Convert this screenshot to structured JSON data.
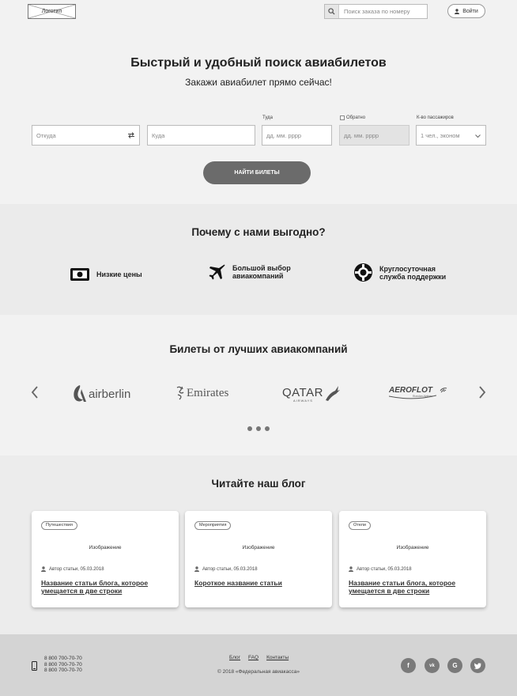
{
  "header": {
    "logo_label": "Логотип",
    "search_placeholder": "Поиск заказа по номеру",
    "login_label": "Войти"
  },
  "hero": {
    "title": "Быстрый и удобный поиск авиабилетов",
    "subtitle": "Закажи авиабилет прямо сейчас!",
    "from_placeholder": "Откуда",
    "to_placeholder": "Куда",
    "depart_label": "Туда",
    "depart_placeholder": "дд. мм. рррр",
    "return_label": "Обратно",
    "return_placeholder": "дд. мм. рррр",
    "passengers_label": "К-во пассажиров",
    "passengers_value": "1 чел., эконом",
    "find_button": "НАЙТИ БИЛЕТЫ"
  },
  "why": {
    "title": "Почему с нами выгодно?",
    "features": [
      {
        "icon": "money-icon",
        "line1": "Низкие цены",
        "line2": ""
      },
      {
        "icon": "airplane-icon",
        "line1": "Большой выбор",
        "line2": "авиакомпаний"
      },
      {
        "icon": "lifebuoy-icon",
        "line1": "Круглосуточная",
        "line2": "служба поддержки"
      }
    ]
  },
  "airlines": {
    "title": "Билеты от лучших авиакомпаний",
    "logos": [
      "airberlin",
      "Emirates",
      "QATAR",
      "AEROFLOT"
    ],
    "qatar_sub": "AIRWAYS",
    "aeroflot_sub": "Russian Airlines"
  },
  "blog": {
    "title": "Читайте наш блог",
    "cards": [
      {
        "tag": "Путешествия",
        "image": "Изображение",
        "meta": "Автор статьи, 05.03.2018",
        "title": "Название статьи блога, которое умещается в две строки"
      },
      {
        "tag": "Мероприятия",
        "image": "Изображение",
        "meta": "Автор статьи, 05.03.2018",
        "title": "Короткое название статьи"
      },
      {
        "tag": "Отели",
        "image": "Изображение",
        "meta": "Автор статьи, 05.03.2018",
        "title": "Название статьи блога, которое умещается в две строки"
      }
    ]
  },
  "footer": {
    "phones": [
      "8 800 700-70-70",
      "8 800 700-70-70",
      "8 800 700-70-70"
    ],
    "links": [
      "Блог",
      "FAQ",
      "Контакты"
    ],
    "copyright": "© 2018 «Федеральная авиакасса»",
    "social": [
      "f",
      "vk",
      "G",
      "tw"
    ],
    "social_icons": [
      "facebook-icon",
      "vk-icon",
      "google-icon",
      "twitter-icon"
    ]
  },
  "colors": {
    "button": "#6b6b6b",
    "footer_bg": "#d4d4d4",
    "social_bg": "#7a7a7a"
  }
}
